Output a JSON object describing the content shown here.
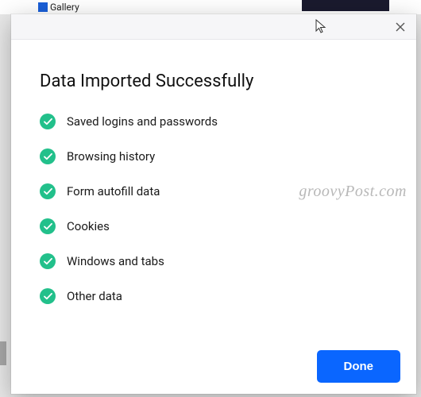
{
  "background": {
    "gallery_label": "Gallery"
  },
  "dialog": {
    "title": "Data Imported Successfully",
    "items": [
      {
        "label": "Saved logins and passwords"
      },
      {
        "label": "Browsing history"
      },
      {
        "label": "Form autofill data"
      },
      {
        "label": "Cookies"
      },
      {
        "label": "Windows and tabs"
      },
      {
        "label": "Other data"
      }
    ],
    "done_label": "Done"
  },
  "watermark": "groovyPost.com"
}
